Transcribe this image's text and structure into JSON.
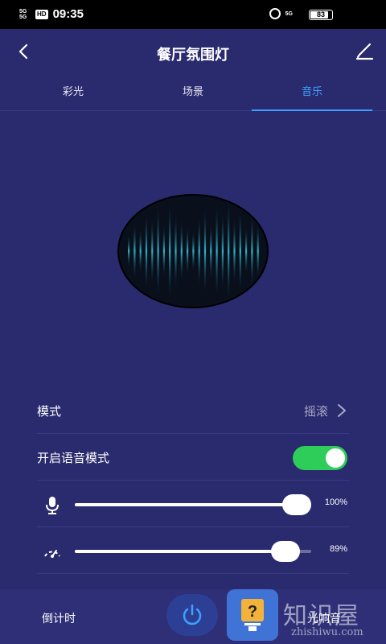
{
  "status_bar": {
    "signal1": "5G",
    "signal2": "5G",
    "hd": "HD",
    "time": "09:35",
    "right_signal": "5G",
    "battery": "83"
  },
  "header": {
    "title": "餐厅氛围灯"
  },
  "tabs": [
    {
      "label": "彩光",
      "active": false
    },
    {
      "label": "场景",
      "active": false
    },
    {
      "label": "音乐",
      "active": true
    }
  ],
  "mode": {
    "label": "模式",
    "value": "摇滚"
  },
  "voice_mode": {
    "label": "开启语音模式",
    "enabled": true
  },
  "mic_slider": {
    "value_text": "100%",
    "level": 1.0
  },
  "speed_slider": {
    "value_text": "89%",
    "level": 0.89
  },
  "bottom_bar": {
    "left_label": "倒计时",
    "right_label": "光响音"
  },
  "watermark": {
    "main": "知识屋",
    "sub": "zhishiwu.com"
  },
  "colors": {
    "background": "#2a2a6e",
    "accent": "#3fa1ff",
    "toggle_on": "#2ecc59"
  }
}
